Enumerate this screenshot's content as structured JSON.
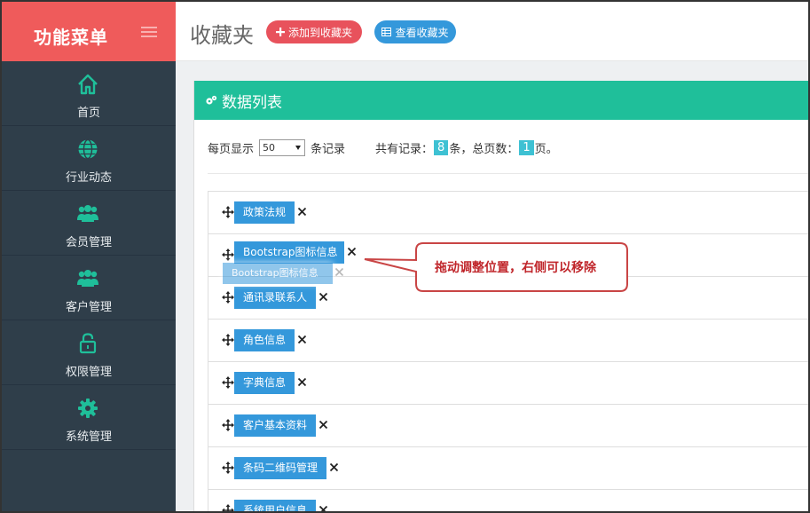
{
  "sidebar": {
    "title": "功能菜单",
    "items": [
      {
        "label": "首页",
        "icon": "home-icon"
      },
      {
        "label": "行业动态",
        "icon": "globe-icon"
      },
      {
        "label": "会员管理",
        "icon": "users-icon"
      },
      {
        "label": "客户管理",
        "icon": "users-icon"
      },
      {
        "label": "权限管理",
        "icon": "lock-icon"
      },
      {
        "label": "系统管理",
        "icon": "gear-icon"
      }
    ],
    "icon_color": "#1fbf9a",
    "header_color": "#ef5b5b",
    "background": "#2f3e4a"
  },
  "header": {
    "title": "收藏夹",
    "add_button": "添加到收藏夹",
    "view_button": "查看收藏夹"
  },
  "panel": {
    "title": "数据列表",
    "per_page_label": "每页显示",
    "per_page_value": "50",
    "records_unit": "条记录",
    "total_label": "共有记录：",
    "total_count": "8",
    "total_unit": "条，总页数：",
    "page_count": "1",
    "page_unit": "页。",
    "accent": "#1fbf9a"
  },
  "list": {
    "items": [
      "政策法规",
      "Bootstrap图标信息",
      "通讯录联系人",
      "角色信息",
      "字典信息",
      "客户基本资料",
      "条码二维码管理",
      "系统用户信息"
    ],
    "dragging_label": "Bootstrap图标信息"
  },
  "annotation": {
    "text": "拖动调整位置，右侧可以移除"
  }
}
